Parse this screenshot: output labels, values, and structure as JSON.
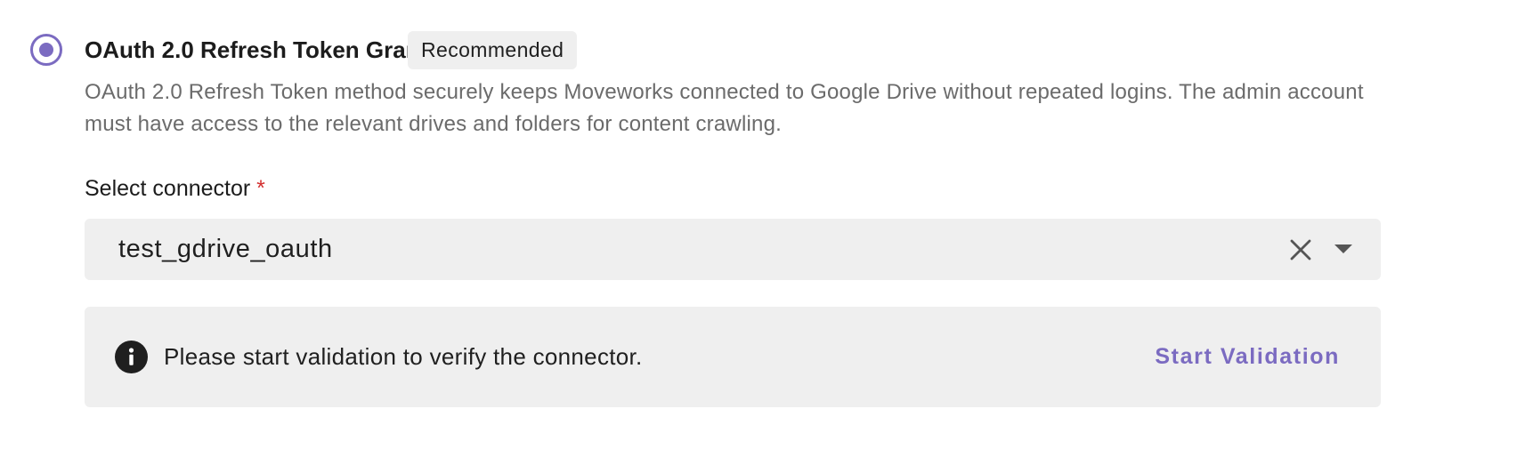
{
  "auth_option": {
    "selected": true,
    "title": "OAuth 2.0 Refresh Token Grant",
    "badge": "Recommended",
    "description": "OAuth 2.0 Refresh Token method securely keeps Moveworks connected to Google Drive without repeated logins. The admin account must have access to the relevant drives and folders for content crawling."
  },
  "connector_field": {
    "label": "Select connector",
    "required_marker": "*",
    "value": "test_gdrive_oauth",
    "clear_icon": "close-icon",
    "dropdown_icon": "caret-down-icon"
  },
  "validation_alert": {
    "icon": "info-icon",
    "message": "Please start validation to verify the connector.",
    "action_label": "Start Validation"
  },
  "colors": {
    "accent": "#7b6bc1",
    "required": "#d32f2f",
    "surface": "#efefef",
    "muted_text": "#6b6b6b"
  }
}
